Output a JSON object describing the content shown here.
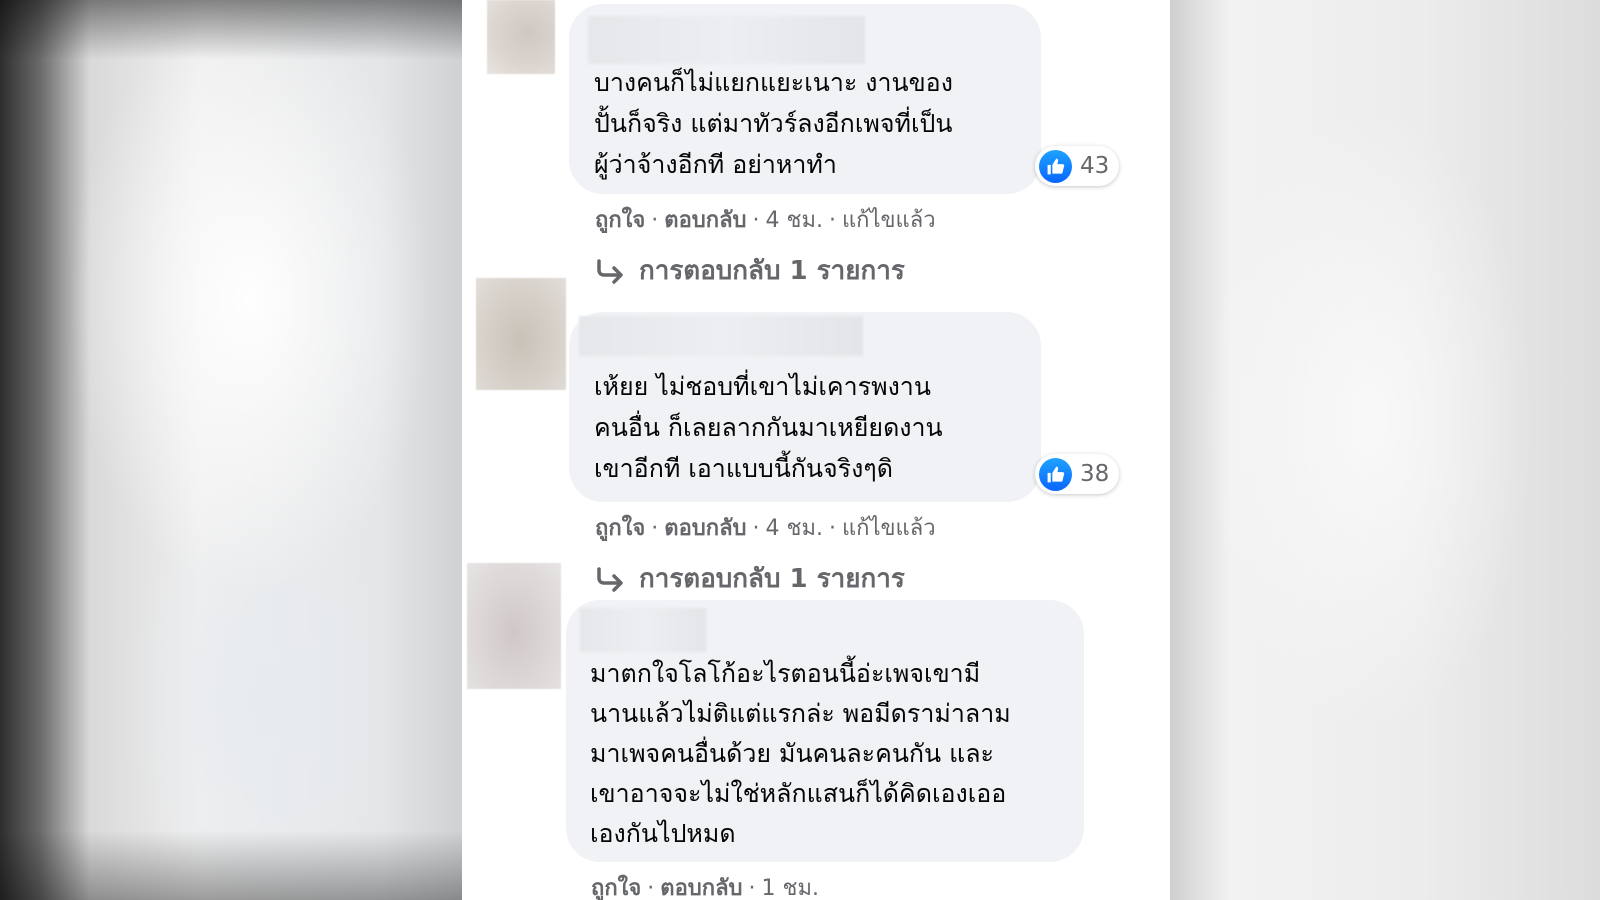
{
  "comments": [
    {
      "text": "บางคนก็ไม่แยกแยะเนาะ งานของ\nปั้นก็จริง แต่มาทัวร์ลงอีกเพจที่เป็น\nผู้ว่าจ้างอีกที อย่าหาทำ",
      "reaction_count": "43",
      "like_label": "ถูกใจ",
      "reply_label": "ตอบกลับ",
      "time": "4 ชม.",
      "edited_label": "แก้ไขแล้ว",
      "replies_label": "การตอบกลับ 1 รายการ"
    },
    {
      "text": "เห้ยย ไม่ชอบที่เขาไม่เคารพงาน\nคนอื่น ก็เลยลากกันมาเหยียดงาน\nเขาอีกที เอาแบบนี้กันจริงๆดิ",
      "reaction_count": "38",
      "like_label": "ถูกใจ",
      "reply_label": "ตอบกลับ",
      "time": "4 ชม.",
      "edited_label": "แก้ไขแล้ว",
      "replies_label": "การตอบกลับ 1 รายการ"
    },
    {
      "text": "มาตกใจโลโก้อะไรตอนนี้อ่ะเพจเขามี\nนานแล้วไม่ติแต่แรกล่ะ พอมีดราม่าลาม\nมาเพจคนอื่นด้วย มันคนละคนกัน และ\nเขาอาจจะไม่ใช่หลักแสนก็ได้คิดเองเออ\nเองกันไปหมด",
      "like_label": "ถูกใจ",
      "reply_label": "ตอบกลับ",
      "time": "1 ชม."
    }
  ],
  "colors": {
    "bubble": "#f0f2f5",
    "meta_text": "#65676b",
    "like_blue": "#0866ff",
    "body_text": "#050505"
  },
  "icons": {
    "like": "thumbs-up-icon",
    "reply_arrow": "reply-arrow-icon"
  }
}
